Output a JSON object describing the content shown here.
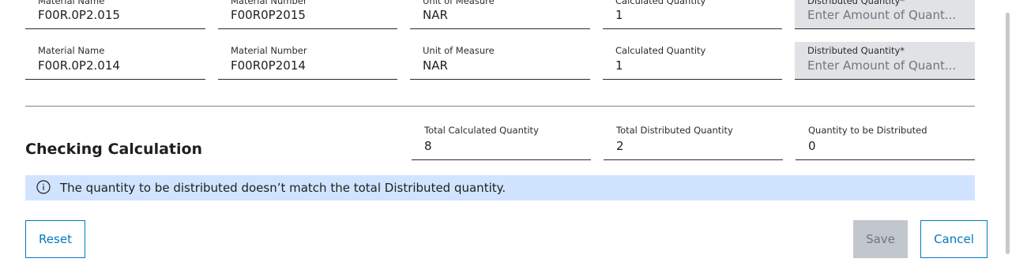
{
  "rows": [
    {
      "material_name_label": "Material Name",
      "material_name": "F00R.0P2.015",
      "material_number_label": "Material Number",
      "material_number": "F00R0P2015",
      "uom_label": "Unit of Measure",
      "uom": "NAR",
      "calc_qty_label": "Calculated Quantity",
      "calc_qty": "1",
      "dist_qty_label": "Distributed Quantity*",
      "dist_qty_placeholder": "Enter Amount of Quant..."
    },
    {
      "material_name_label": "Material Name",
      "material_name": "F00R.0P2.014",
      "material_number_label": "Material Number",
      "material_number": "F00R0P2014",
      "uom_label": "Unit of Measure",
      "uom": "NAR",
      "calc_qty_label": "Calculated Quantity",
      "calc_qty": "1",
      "dist_qty_label": "Distributed Quantity*",
      "dist_qty_placeholder": "Enter Amount of Quant..."
    }
  ],
  "checking": {
    "title": "Checking Calculation",
    "total_calc_label": "Total Calculated Quantity",
    "total_calc": "8",
    "total_dist_label": "Total Distributed Quantity",
    "total_dist": "2",
    "to_distribute_label": "Quantity to be Distributed",
    "to_distribute": "0"
  },
  "notice": {
    "icon": "info-icon",
    "text": "The quantity to be distributed doesn’t match the total Distributed quantity."
  },
  "buttons": {
    "reset": "Reset",
    "save": "Save",
    "cancel": "Cancel"
  },
  "colors": {
    "accent": "#007bc0",
    "notice_bg": "#d1e4ff",
    "disabled_bg": "#c1c7cc",
    "input_bg": "#e0e2e5"
  }
}
